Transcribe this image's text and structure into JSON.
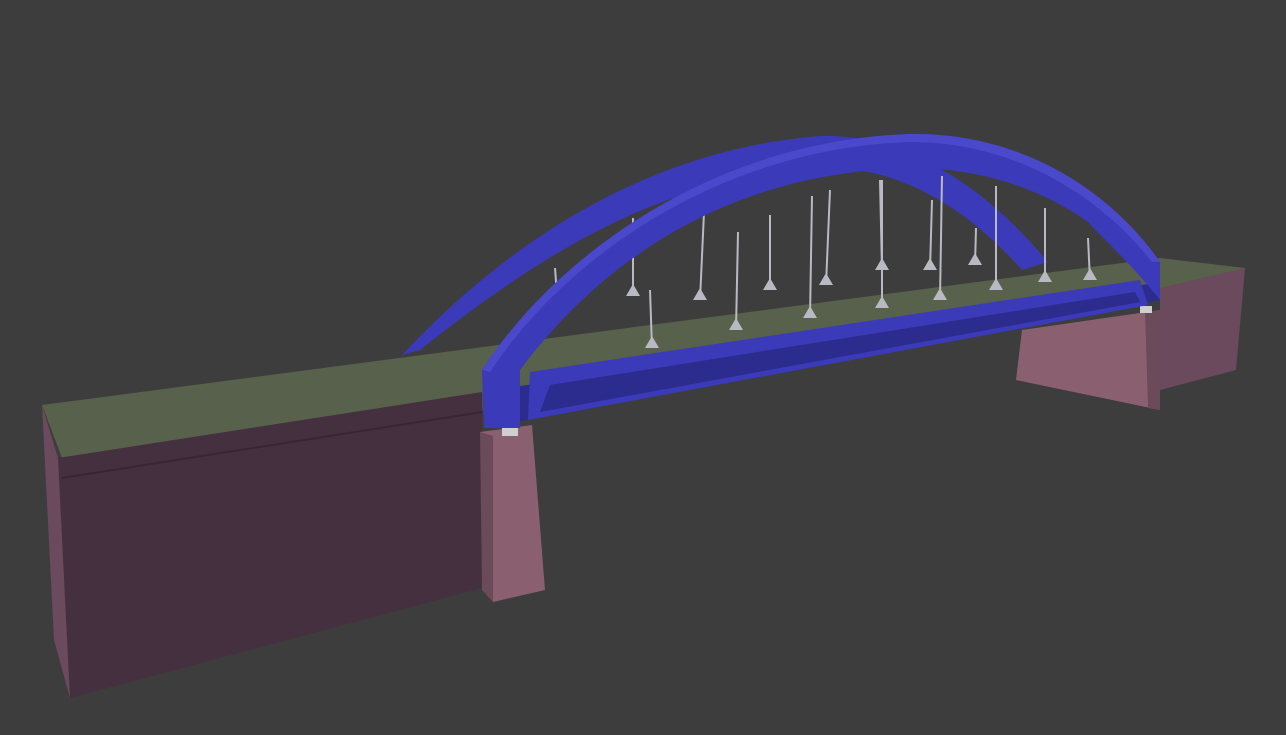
{
  "viewport": {
    "background_color": "#3d3d3d"
  },
  "scene": {
    "object": "arch-bridge",
    "colors": {
      "arch_main": "#3b3ab8",
      "arch_shade": "#2c2b8e",
      "arch_light": "#4a49cc",
      "deck_top": "#58614b",
      "deck_edge": "#4a5140",
      "abutment_front": "#45303f",
      "abutment_side": "#6a4a5c",
      "pier_front": "#8a6070",
      "pier_side": "#6b4a5a",
      "hanger": "#b9b9c3",
      "bearing": "#cfcfcf"
    }
  }
}
